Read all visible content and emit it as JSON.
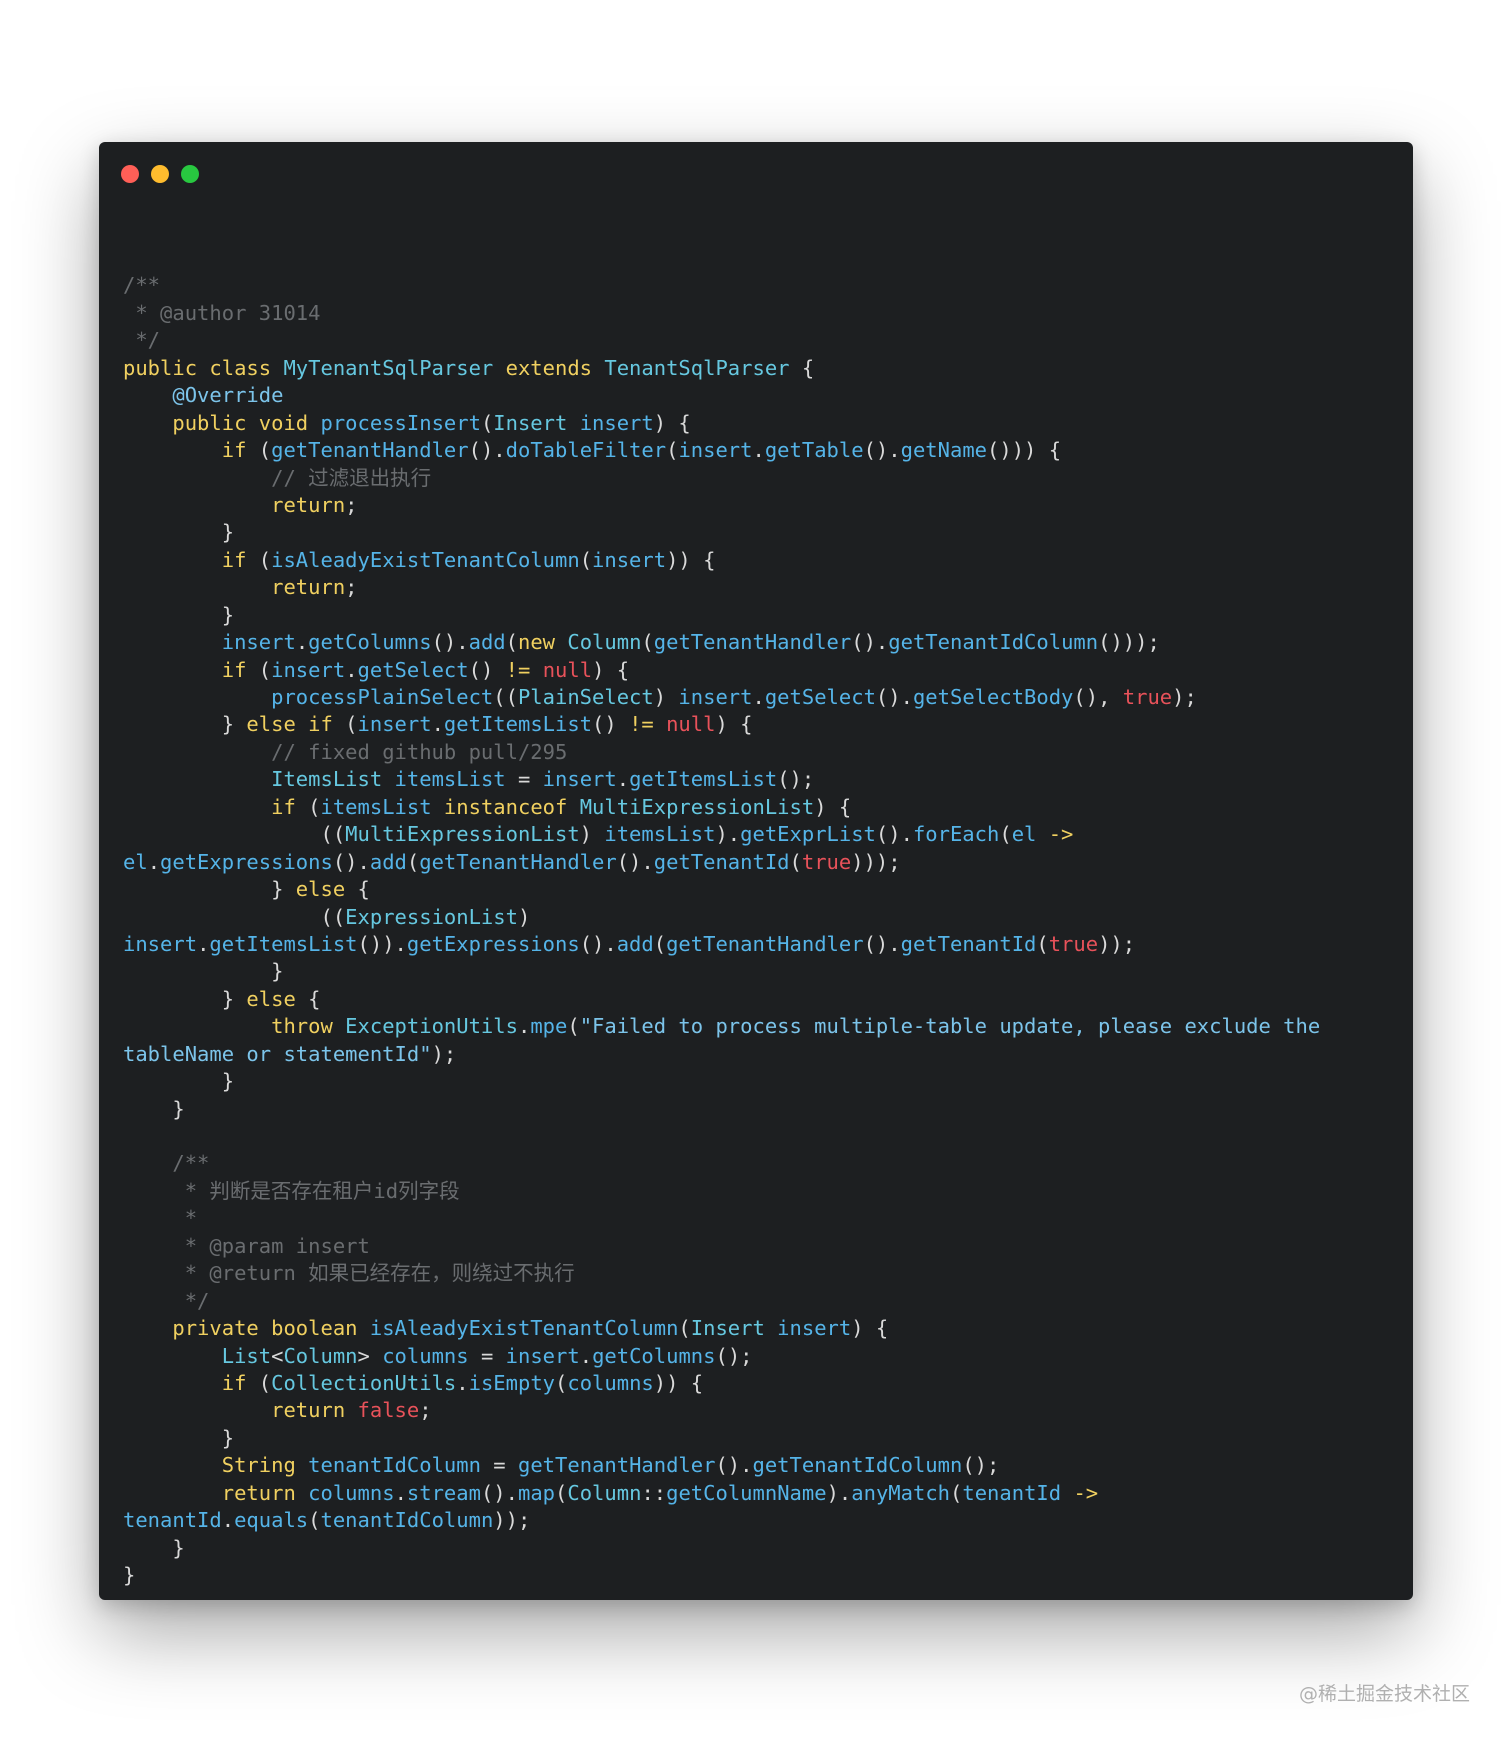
{
  "window": {
    "controls": [
      "close",
      "minimize",
      "zoom"
    ],
    "colors": {
      "close": "#ff5f57",
      "minimize": "#febc2e",
      "zoom": "#28c840",
      "background": "#1d1f21"
    }
  },
  "code": {
    "language": "java",
    "lines": [
      [],
      [
        {
          "t": "/**",
          "c": "comment"
        }
      ],
      [
        {
          "t": " * @author 31014",
          "c": "comment"
        }
      ],
      [
        {
          "t": " */",
          "c": "comment"
        }
      ],
      [
        {
          "t": "public class ",
          "c": "kw"
        },
        {
          "t": "MyTenantSqlParser",
          "c": "type"
        },
        {
          "t": " extends ",
          "c": "kw"
        },
        {
          "t": "TenantSqlParser",
          "c": "type"
        },
        {
          "t": " {",
          "c": "plain"
        }
      ],
      [
        {
          "t": "    ",
          "c": "plain"
        },
        {
          "t": "@Override",
          "c": "ann"
        }
      ],
      [
        {
          "t": "    ",
          "c": "plain"
        },
        {
          "t": "public void ",
          "c": "kw"
        },
        {
          "t": "processInsert",
          "c": "fn"
        },
        {
          "t": "(",
          "c": "plain"
        },
        {
          "t": "Insert",
          "c": "type"
        },
        {
          "t": " ",
          "c": "plain"
        },
        {
          "t": "insert",
          "c": "id"
        },
        {
          "t": ") {",
          "c": "plain"
        }
      ],
      [
        {
          "t": "        ",
          "c": "plain"
        },
        {
          "t": "if",
          "c": "kw"
        },
        {
          "t": " (",
          "c": "plain"
        },
        {
          "t": "getTenantHandler",
          "c": "fn"
        },
        {
          "t": "().",
          "c": "plain"
        },
        {
          "t": "doTableFilter",
          "c": "fn"
        },
        {
          "t": "(",
          "c": "plain"
        },
        {
          "t": "insert",
          "c": "id"
        },
        {
          "t": ".",
          "c": "plain"
        },
        {
          "t": "getTable",
          "c": "fn"
        },
        {
          "t": "().",
          "c": "plain"
        },
        {
          "t": "getName",
          "c": "fn"
        },
        {
          "t": "())) {",
          "c": "plain"
        }
      ],
      [
        {
          "t": "            ",
          "c": "plain"
        },
        {
          "t": "// 过滤退出执行",
          "c": "comment"
        }
      ],
      [
        {
          "t": "            ",
          "c": "plain"
        },
        {
          "t": "return",
          "c": "kw"
        },
        {
          "t": ";",
          "c": "plain"
        }
      ],
      [
        {
          "t": "        }",
          "c": "plain"
        }
      ],
      [
        {
          "t": "        ",
          "c": "plain"
        },
        {
          "t": "if",
          "c": "kw"
        },
        {
          "t": " (",
          "c": "plain"
        },
        {
          "t": "isAleadyExistTenantColumn",
          "c": "fn"
        },
        {
          "t": "(",
          "c": "plain"
        },
        {
          "t": "insert",
          "c": "id"
        },
        {
          "t": ")) {",
          "c": "plain"
        }
      ],
      [
        {
          "t": "            ",
          "c": "plain"
        },
        {
          "t": "return",
          "c": "kw"
        },
        {
          "t": ";",
          "c": "plain"
        }
      ],
      [
        {
          "t": "        }",
          "c": "plain"
        }
      ],
      [
        {
          "t": "        ",
          "c": "plain"
        },
        {
          "t": "insert",
          "c": "id"
        },
        {
          "t": ".",
          "c": "plain"
        },
        {
          "t": "getColumns",
          "c": "fn"
        },
        {
          "t": "().",
          "c": "plain"
        },
        {
          "t": "add",
          "c": "fn"
        },
        {
          "t": "(",
          "c": "plain"
        },
        {
          "t": "new",
          "c": "kw"
        },
        {
          "t": " ",
          "c": "plain"
        },
        {
          "t": "Column",
          "c": "type"
        },
        {
          "t": "(",
          "c": "plain"
        },
        {
          "t": "getTenantHandler",
          "c": "fn"
        },
        {
          "t": "().",
          "c": "plain"
        },
        {
          "t": "getTenantIdColumn",
          "c": "fn"
        },
        {
          "t": "()));",
          "c": "plain"
        }
      ],
      [
        {
          "t": "        ",
          "c": "plain"
        },
        {
          "t": "if",
          "c": "kw"
        },
        {
          "t": " (",
          "c": "plain"
        },
        {
          "t": "insert",
          "c": "id"
        },
        {
          "t": ".",
          "c": "plain"
        },
        {
          "t": "getSelect",
          "c": "fn"
        },
        {
          "t": "() ",
          "c": "plain"
        },
        {
          "t": "!=",
          "c": "kw"
        },
        {
          "t": " ",
          "c": "plain"
        },
        {
          "t": "null",
          "c": "lit"
        },
        {
          "t": ") {",
          "c": "plain"
        }
      ],
      [
        {
          "t": "            ",
          "c": "plain"
        },
        {
          "t": "processPlainSelect",
          "c": "fn"
        },
        {
          "t": "((",
          "c": "plain"
        },
        {
          "t": "PlainSelect",
          "c": "type"
        },
        {
          "t": ") ",
          "c": "plain"
        },
        {
          "t": "insert",
          "c": "id"
        },
        {
          "t": ".",
          "c": "plain"
        },
        {
          "t": "getSelect",
          "c": "fn"
        },
        {
          "t": "().",
          "c": "plain"
        },
        {
          "t": "getSelectBody",
          "c": "fn"
        },
        {
          "t": "(), ",
          "c": "plain"
        },
        {
          "t": "true",
          "c": "lit"
        },
        {
          "t": ");",
          "c": "plain"
        }
      ],
      [
        {
          "t": "        } ",
          "c": "plain"
        },
        {
          "t": "else if",
          "c": "kw"
        },
        {
          "t": " (",
          "c": "plain"
        },
        {
          "t": "insert",
          "c": "id"
        },
        {
          "t": ".",
          "c": "plain"
        },
        {
          "t": "getItemsList",
          "c": "fn"
        },
        {
          "t": "() ",
          "c": "plain"
        },
        {
          "t": "!=",
          "c": "kw"
        },
        {
          "t": " ",
          "c": "plain"
        },
        {
          "t": "null",
          "c": "lit"
        },
        {
          "t": ") {",
          "c": "plain"
        }
      ],
      [
        {
          "t": "            ",
          "c": "plain"
        },
        {
          "t": "// fixed github pull/295",
          "c": "comment"
        }
      ],
      [
        {
          "t": "            ",
          "c": "plain"
        },
        {
          "t": "ItemsList",
          "c": "type"
        },
        {
          "t": " ",
          "c": "plain"
        },
        {
          "t": "itemsList",
          "c": "id"
        },
        {
          "t": " = ",
          "c": "plain"
        },
        {
          "t": "insert",
          "c": "id"
        },
        {
          "t": ".",
          "c": "plain"
        },
        {
          "t": "getItemsList",
          "c": "fn"
        },
        {
          "t": "();",
          "c": "plain"
        }
      ],
      [
        {
          "t": "            ",
          "c": "plain"
        },
        {
          "t": "if",
          "c": "kw"
        },
        {
          "t": " (",
          "c": "plain"
        },
        {
          "t": "itemsList",
          "c": "id"
        },
        {
          "t": " ",
          "c": "plain"
        },
        {
          "t": "instanceof",
          "c": "kw"
        },
        {
          "t": " ",
          "c": "plain"
        },
        {
          "t": "MultiExpressionList",
          "c": "type"
        },
        {
          "t": ") {",
          "c": "plain"
        }
      ],
      [
        {
          "t": "                ((",
          "c": "plain"
        },
        {
          "t": "MultiExpressionList",
          "c": "type"
        },
        {
          "t": ") ",
          "c": "plain"
        },
        {
          "t": "itemsList",
          "c": "id"
        },
        {
          "t": ").",
          "c": "plain"
        },
        {
          "t": "getExprList",
          "c": "fn"
        },
        {
          "t": "().",
          "c": "plain"
        },
        {
          "t": "forEach",
          "c": "fn"
        },
        {
          "t": "(",
          "c": "plain"
        },
        {
          "t": "el",
          "c": "id"
        },
        {
          "t": " ",
          "c": "plain"
        },
        {
          "t": "->",
          "c": "kw"
        }
      ],
      [
        {
          "t": "el",
          "c": "id"
        },
        {
          "t": ".",
          "c": "plain"
        },
        {
          "t": "getExpressions",
          "c": "fn"
        },
        {
          "t": "().",
          "c": "plain"
        },
        {
          "t": "add",
          "c": "fn"
        },
        {
          "t": "(",
          "c": "plain"
        },
        {
          "t": "getTenantHandler",
          "c": "fn"
        },
        {
          "t": "().",
          "c": "plain"
        },
        {
          "t": "getTenantId",
          "c": "fn"
        },
        {
          "t": "(",
          "c": "plain"
        },
        {
          "t": "true",
          "c": "lit"
        },
        {
          "t": ")));",
          "c": "plain"
        }
      ],
      [
        {
          "t": "            } ",
          "c": "plain"
        },
        {
          "t": "else",
          "c": "kw"
        },
        {
          "t": " {",
          "c": "plain"
        }
      ],
      [
        {
          "t": "                ((",
          "c": "plain"
        },
        {
          "t": "ExpressionList",
          "c": "type"
        },
        {
          "t": ")",
          "c": "plain"
        }
      ],
      [
        {
          "t": "insert",
          "c": "id"
        },
        {
          "t": ".",
          "c": "plain"
        },
        {
          "t": "getItemsList",
          "c": "fn"
        },
        {
          "t": "()).",
          "c": "plain"
        },
        {
          "t": "getExpressions",
          "c": "fn"
        },
        {
          "t": "().",
          "c": "plain"
        },
        {
          "t": "add",
          "c": "fn"
        },
        {
          "t": "(",
          "c": "plain"
        },
        {
          "t": "getTenantHandler",
          "c": "fn"
        },
        {
          "t": "().",
          "c": "plain"
        },
        {
          "t": "getTenantId",
          "c": "fn"
        },
        {
          "t": "(",
          "c": "plain"
        },
        {
          "t": "true",
          "c": "lit"
        },
        {
          "t": "));",
          "c": "plain"
        }
      ],
      [
        {
          "t": "            }",
          "c": "plain"
        }
      ],
      [
        {
          "t": "        } ",
          "c": "plain"
        },
        {
          "t": "else",
          "c": "kw"
        },
        {
          "t": " {",
          "c": "plain"
        }
      ],
      [
        {
          "t": "            ",
          "c": "plain"
        },
        {
          "t": "throw",
          "c": "kw"
        },
        {
          "t": " ",
          "c": "plain"
        },
        {
          "t": "ExceptionUtils",
          "c": "type"
        },
        {
          "t": ".",
          "c": "plain"
        },
        {
          "t": "mpe",
          "c": "fn"
        },
        {
          "t": "(",
          "c": "plain"
        },
        {
          "t": "\"Failed to process multiple-table update, please exclude the",
          "c": "str"
        }
      ],
      [
        {
          "t": "tableName or statementId\"",
          "c": "str"
        },
        {
          "t": ");",
          "c": "plain"
        }
      ],
      [
        {
          "t": "        }",
          "c": "plain"
        }
      ],
      [
        {
          "t": "    }",
          "c": "plain"
        }
      ],
      [],
      [
        {
          "t": "    /**",
          "c": "comment"
        }
      ],
      [
        {
          "t": "     * 判断是否存在租户id列字段",
          "c": "comment"
        }
      ],
      [
        {
          "t": "     *",
          "c": "comment"
        }
      ],
      [
        {
          "t": "     * @param insert",
          "c": "comment"
        }
      ],
      [
        {
          "t": "     * @return 如果已经存在，则绕过不执行",
          "c": "comment"
        }
      ],
      [
        {
          "t": "     */",
          "c": "comment"
        }
      ],
      [
        {
          "t": "    ",
          "c": "plain"
        },
        {
          "t": "private boolean ",
          "c": "kw"
        },
        {
          "t": "isAleadyExistTenantColumn",
          "c": "fn"
        },
        {
          "t": "(",
          "c": "plain"
        },
        {
          "t": "Insert",
          "c": "type"
        },
        {
          "t": " ",
          "c": "plain"
        },
        {
          "t": "insert",
          "c": "id"
        },
        {
          "t": ") {",
          "c": "plain"
        }
      ],
      [
        {
          "t": "        ",
          "c": "plain"
        },
        {
          "t": "List",
          "c": "type"
        },
        {
          "t": "<",
          "c": "plain"
        },
        {
          "t": "Column",
          "c": "type"
        },
        {
          "t": "> ",
          "c": "plain"
        },
        {
          "t": "columns",
          "c": "id"
        },
        {
          "t": " = ",
          "c": "plain"
        },
        {
          "t": "insert",
          "c": "id"
        },
        {
          "t": ".",
          "c": "plain"
        },
        {
          "t": "getColumns",
          "c": "fn"
        },
        {
          "t": "();",
          "c": "plain"
        }
      ],
      [
        {
          "t": "        ",
          "c": "plain"
        },
        {
          "t": "if",
          "c": "kw"
        },
        {
          "t": " (",
          "c": "plain"
        },
        {
          "t": "CollectionUtils",
          "c": "type"
        },
        {
          "t": ".",
          "c": "plain"
        },
        {
          "t": "isEmpty",
          "c": "fn"
        },
        {
          "t": "(",
          "c": "plain"
        },
        {
          "t": "columns",
          "c": "id"
        },
        {
          "t": ")) {",
          "c": "plain"
        }
      ],
      [
        {
          "t": "            ",
          "c": "plain"
        },
        {
          "t": "return",
          "c": "kw"
        },
        {
          "t": " ",
          "c": "plain"
        },
        {
          "t": "false",
          "c": "lit"
        },
        {
          "t": ";",
          "c": "plain"
        }
      ],
      [
        {
          "t": "        }",
          "c": "plain"
        }
      ],
      [
        {
          "t": "        ",
          "c": "plain"
        },
        {
          "t": "String",
          "c": "kw"
        },
        {
          "t": " ",
          "c": "plain"
        },
        {
          "t": "tenantIdColumn",
          "c": "id"
        },
        {
          "t": " = ",
          "c": "plain"
        },
        {
          "t": "getTenantHandler",
          "c": "fn"
        },
        {
          "t": "().",
          "c": "plain"
        },
        {
          "t": "getTenantIdColumn",
          "c": "fn"
        },
        {
          "t": "();",
          "c": "plain"
        }
      ],
      [
        {
          "t": "        ",
          "c": "plain"
        },
        {
          "t": "return",
          "c": "kw"
        },
        {
          "t": " ",
          "c": "plain"
        },
        {
          "t": "columns",
          "c": "id"
        },
        {
          "t": ".",
          "c": "plain"
        },
        {
          "t": "stream",
          "c": "fn"
        },
        {
          "t": "().",
          "c": "plain"
        },
        {
          "t": "map",
          "c": "fn"
        },
        {
          "t": "(",
          "c": "plain"
        },
        {
          "t": "Column",
          "c": "type"
        },
        {
          "t": "::",
          "c": "plain"
        },
        {
          "t": "getColumnName",
          "c": "fn"
        },
        {
          "t": ").",
          "c": "plain"
        },
        {
          "t": "anyMatch",
          "c": "fn"
        },
        {
          "t": "(",
          "c": "plain"
        },
        {
          "t": "tenantId",
          "c": "id"
        },
        {
          "t": " ",
          "c": "plain"
        },
        {
          "t": "->",
          "c": "kw"
        }
      ],
      [
        {
          "t": "tenantId",
          "c": "id"
        },
        {
          "t": ".",
          "c": "plain"
        },
        {
          "t": "equals",
          "c": "fn"
        },
        {
          "t": "(",
          "c": "plain"
        },
        {
          "t": "tenantIdColumn",
          "c": "id"
        },
        {
          "t": "));",
          "c": "plain"
        }
      ],
      [
        {
          "t": "    }",
          "c": "plain"
        }
      ],
      [
        {
          "t": "}",
          "c": "plain"
        }
      ]
    ]
  },
  "watermark": {
    "text": "@稀土掘金技术社区"
  }
}
